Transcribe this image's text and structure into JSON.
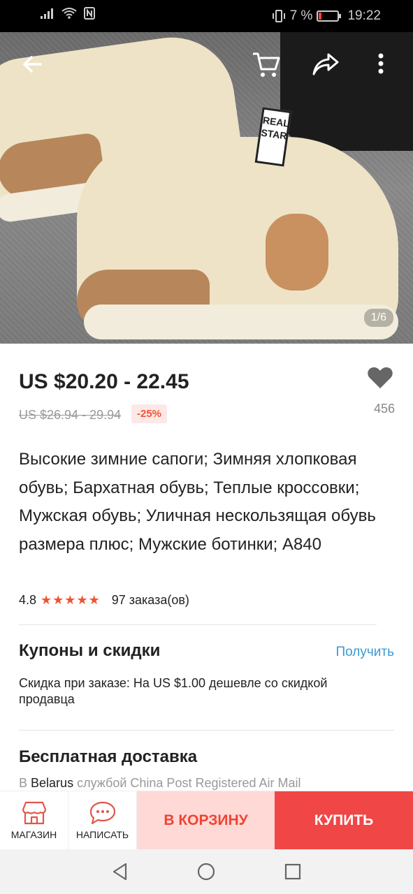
{
  "status": {
    "battery": "7 %",
    "time": "19:22"
  },
  "hero": {
    "counter": "1/6",
    "tag_text": "REAL STAR"
  },
  "product": {
    "price": "US $20.20 - 22.45",
    "old_price": "US $26.94 - 29.94",
    "discount": "-25%",
    "wishlist_count": "456",
    "title": "Высокие зимние сапоги; Зимняя хлопковая обувь; Бархатная обувь; Теплые кроссовки; Мужская обувь; Уличная нескользящая обувь размера плюс; Мужские ботинки; A840",
    "rating": "4.8",
    "stars": "★★★★★",
    "orders": "97 заказа(ов)"
  },
  "coupons": {
    "heading": "Купоны и скидки",
    "link": "Получить",
    "text": "Скидка при заказе: На US $1.00 дешевле со скидкой продавца"
  },
  "shipping": {
    "heading": "Бесплатная доставка",
    "prefix": "В",
    "country": "Belarus",
    "suffix": "службой China Post Registered Air Mail"
  },
  "actions": {
    "store": "МАГАЗИН",
    "message": "НАПИСАТЬ",
    "add_to_cart": "В КОРЗИНУ",
    "buy": "КУПИТЬ"
  },
  "colors": {
    "accent": "#f04646",
    "cart_bg": "#ffd9d6",
    "link": "#3a9bd5"
  }
}
